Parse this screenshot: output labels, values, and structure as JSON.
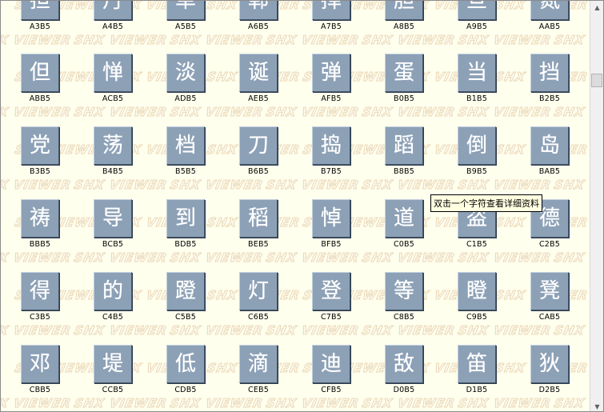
{
  "tooltip": {
    "text": "双击一个字符查看详细资料"
  },
  "watermark": {
    "text": "SHX VIEWER"
  },
  "scrollbar": {
    "up_icon": "arrow-up-icon",
    "down_icon": "arrow-down-icon",
    "position_fraction": 0.16
  },
  "colors": {
    "tile": "#8ca0b6",
    "background": "#ffffee",
    "watermark_outline": "#e9d6b4"
  },
  "rows": [
    {
      "cells": [
        {
          "glyph": "担",
          "code": "A3B5"
        },
        {
          "glyph": "丹",
          "code": "A4B5"
        },
        {
          "glyph": "单",
          "code": "A5B5"
        },
        {
          "glyph": "郸",
          "code": "A6B5"
        },
        {
          "glyph": "掸",
          "code": "A7B5"
        },
        {
          "glyph": "胆",
          "code": "A8B5"
        },
        {
          "glyph": "旦",
          "code": "A9B5"
        },
        {
          "glyph": "氮",
          "code": "AAB5"
        }
      ]
    },
    {
      "cells": [
        {
          "glyph": "但",
          "code": "ABB5"
        },
        {
          "glyph": "惮",
          "code": "ACB5"
        },
        {
          "glyph": "淡",
          "code": "ADB5"
        },
        {
          "glyph": "诞",
          "code": "AEB5"
        },
        {
          "glyph": "弹",
          "code": "AFB5"
        },
        {
          "glyph": "蛋",
          "code": "B0B5"
        },
        {
          "glyph": "当",
          "code": "B1B5"
        },
        {
          "glyph": "挡",
          "code": "B2B5"
        }
      ]
    },
    {
      "cells": [
        {
          "glyph": "党",
          "code": "B3B5"
        },
        {
          "glyph": "荡",
          "code": "B4B5"
        },
        {
          "glyph": "档",
          "code": "B5B5"
        },
        {
          "glyph": "刀",
          "code": "B6B5"
        },
        {
          "glyph": "捣",
          "code": "B7B5"
        },
        {
          "glyph": "蹈",
          "code": "B8B5"
        },
        {
          "glyph": "倒",
          "code": "B9B5"
        },
        {
          "glyph": "岛",
          "code": "BAB5"
        }
      ]
    },
    {
      "cells": [
        {
          "glyph": "祷",
          "code": "BBB5"
        },
        {
          "glyph": "导",
          "code": "BCB5"
        },
        {
          "glyph": "到",
          "code": "BDB5"
        },
        {
          "glyph": "稻",
          "code": "BEB5"
        },
        {
          "glyph": "悼",
          "code": "BFB5"
        },
        {
          "glyph": "道",
          "code": "C0B5"
        },
        {
          "glyph": "盗",
          "code": "C1B5"
        },
        {
          "glyph": "德",
          "code": "C2B5"
        }
      ]
    },
    {
      "cells": [
        {
          "glyph": "得",
          "code": "C3B5"
        },
        {
          "glyph": "的",
          "code": "C4B5"
        },
        {
          "glyph": "蹬",
          "code": "C5B5"
        },
        {
          "glyph": "灯",
          "code": "C6B5"
        },
        {
          "glyph": "登",
          "code": "C7B5"
        },
        {
          "glyph": "等",
          "code": "C8B5"
        },
        {
          "glyph": "瞪",
          "code": "C9B5"
        },
        {
          "glyph": "凳",
          "code": "CAB5"
        }
      ]
    },
    {
      "cells": [
        {
          "glyph": "邓",
          "code": "CBB5"
        },
        {
          "glyph": "堤",
          "code": "CCB5"
        },
        {
          "glyph": "低",
          "code": "CDB5"
        },
        {
          "glyph": "滴",
          "code": "CEB5"
        },
        {
          "glyph": "迪",
          "code": "CFB5"
        },
        {
          "glyph": "敌",
          "code": "D0B5"
        },
        {
          "glyph": "笛",
          "code": "D1B5"
        },
        {
          "glyph": "狄",
          "code": "D2B5"
        }
      ]
    }
  ]
}
